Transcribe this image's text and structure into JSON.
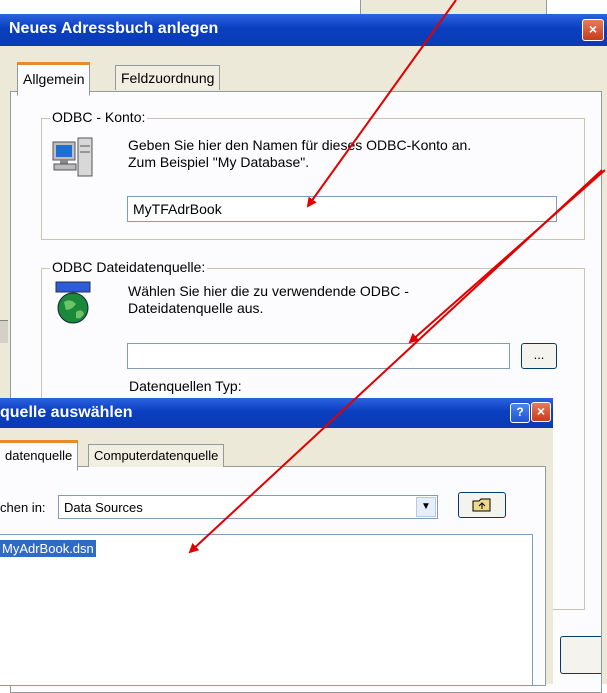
{
  "dialog1": {
    "title": "Neues Adressbuch anlegen",
    "close_label": "×",
    "tabs": [
      "Allgemein",
      "Feldzuordnung"
    ],
    "odbc_konto": {
      "legend": "ODBC - Konto:",
      "text_line1": "Geben Sie hier den Namen für dieses ODBC-Konto an.",
      "text_line2": "Zum Beispiel \"My Database\".",
      "value": "MyTFAdrBook"
    },
    "dateidatenquelle": {
      "legend": "ODBC Dateidatenquelle:",
      "text_line1": "Wählen Sie hier die zu verwendende ODBC -",
      "text_line2": "Dateidatenquelle aus.",
      "value": "",
      "browse_label": "...",
      "type_label": "Datenquellen Typ:"
    }
  },
  "dialog2": {
    "title": "quelle auswählen",
    "help_label": "?",
    "close_label": "×",
    "tabs": [
      "datenquelle",
      "Computerdatenquelle"
    ],
    "look_in_label": "chen in:",
    "look_in_value": "Data Sources",
    "files": [
      "MyAdrBook.dsn"
    ]
  },
  "colors": {
    "arrow": "#e00000",
    "titlebar": "#0a3fc0",
    "selection": "#316ac5"
  }
}
